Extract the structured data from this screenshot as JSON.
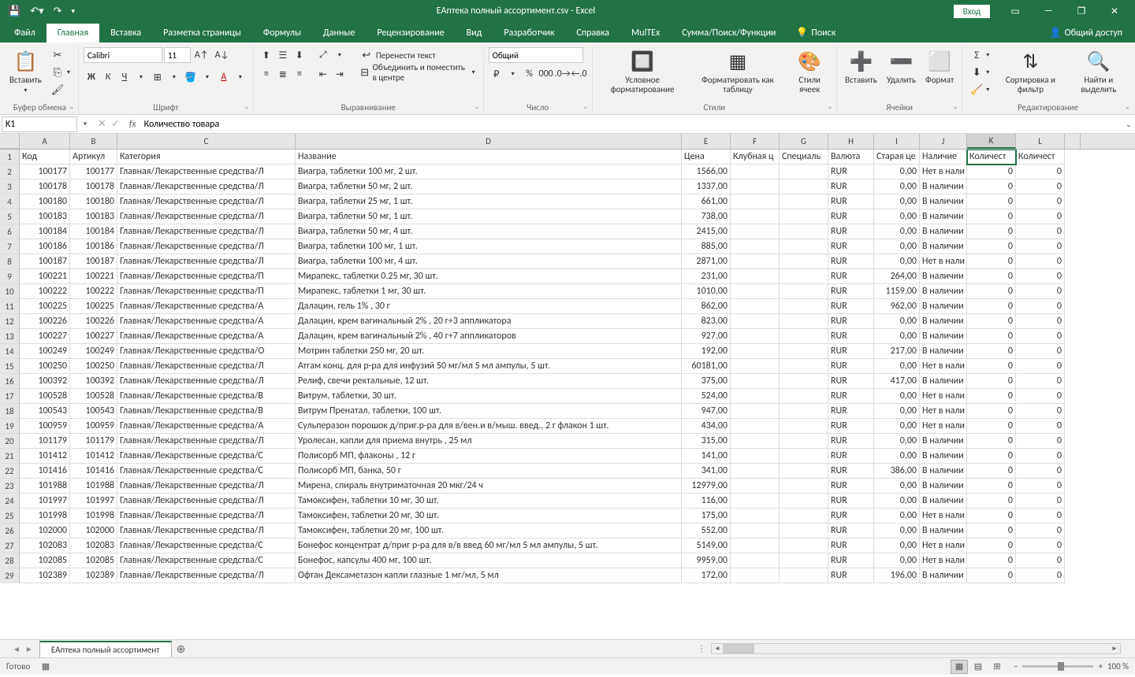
{
  "title": "ЕАптека полный ассортимент.csv - Excel",
  "login": "Вход",
  "tabs": [
    "Файл",
    "Главная",
    "Вставка",
    "Разметка страницы",
    "Формулы",
    "Данные",
    "Рецензирование",
    "Вид",
    "Разработчик",
    "Справка",
    "MulTEx",
    "Сумма/Поиск/Функции"
  ],
  "active_tab": "Главная",
  "tell_me": "Поиск",
  "share": "Общий доступ",
  "ribbon": {
    "paste": "Вставить",
    "clipboard_label": "Буфер обмена",
    "font_name": "Calibri",
    "font_size": "11",
    "font_label": "Шрифт",
    "wrap_text": "Перенести текст",
    "merge_center": "Объединить и поместить в центре",
    "alignment_label": "Выравнивание",
    "number_format": "Общий",
    "number_label": "Число",
    "cond_fmt": "Условное форматирование",
    "fmt_table": "Форматировать как таблицу",
    "cell_styles": "Стили ячеек",
    "styles_label": "Стили",
    "insert": "Вставить",
    "delete": "Удалить",
    "format": "Формат",
    "cells_label": "Ячейки",
    "sort_filter": "Сортировка и фильтр",
    "find_select": "Найти и выделить",
    "editing_label": "Редактирование"
  },
  "name_box": "K1",
  "formula_value": "Количество товара",
  "columns": [
    "A",
    "B",
    "C",
    "D",
    "E",
    "F",
    "G",
    "H",
    "I",
    "J",
    "K",
    "L"
  ],
  "selected_col": "K",
  "selected_cell": {
    "row": 1,
    "col": "K"
  },
  "headers": {
    "A": "Код",
    "B": "Артикул",
    "C": "Категория",
    "D": "Название",
    "E": "Цена",
    "F": "Клубная ц",
    "G": "Специаль",
    "H": "Валюта",
    "I": "Старая це",
    "J": "Наличие",
    "K": "Количест",
    "L": "Количест"
  },
  "rows": [
    {
      "n": 2,
      "A": "100177",
      "B": "100177",
      "C": "Главная/Лекарственные средства/Л",
      "D": "Виагра, таблетки 100 мг, 2 шт.",
      "E": "1566,00",
      "H": "RUR",
      "I": "0,00",
      "J": "Нет в нали",
      "K": "0",
      "L": "0"
    },
    {
      "n": 3,
      "A": "100178",
      "B": "100178",
      "C": "Главная/Лекарственные средства/Л",
      "D": "Виагра, таблетки 50 мг, 2 шт.",
      "E": "1337,00",
      "H": "RUR",
      "I": "0,00",
      "J": "В наличии",
      "K": "0",
      "L": "0"
    },
    {
      "n": 4,
      "A": "100180",
      "B": "100180",
      "C": "Главная/Лекарственные средства/Л",
      "D": "Виагра, таблетки 25 мг, 1 шт.",
      "E": "661,00",
      "H": "RUR",
      "I": "0,00",
      "J": "В наличии",
      "K": "0",
      "L": "0"
    },
    {
      "n": 5,
      "A": "100183",
      "B": "100183",
      "C": "Главная/Лекарственные средства/Л",
      "D": "Виагра, таблетки 50 мг, 1 шт.",
      "E": "738,00",
      "H": "RUR",
      "I": "0,00",
      "J": "В наличии",
      "K": "0",
      "L": "0"
    },
    {
      "n": 6,
      "A": "100184",
      "B": "100184",
      "C": "Главная/Лекарственные средства/Л",
      "D": "Виагра, таблетки 50 мг, 4 шт.",
      "E": "2415,00",
      "H": "RUR",
      "I": "0,00",
      "J": "В наличии",
      "K": "0",
      "L": "0"
    },
    {
      "n": 7,
      "A": "100186",
      "B": "100186",
      "C": "Главная/Лекарственные средства/Л",
      "D": "Виагра, таблетки 100 мг, 1 шт.",
      "E": "885,00",
      "H": "RUR",
      "I": "0,00",
      "J": "В наличии",
      "K": "0",
      "L": "0"
    },
    {
      "n": 8,
      "A": "100187",
      "B": "100187",
      "C": "Главная/Лекарственные средства/Л",
      "D": "Виагра, таблетки 100 мг, 4 шт.",
      "E": "2871,00",
      "H": "RUR",
      "I": "0,00",
      "J": "Нет в нали",
      "K": "0",
      "L": "0"
    },
    {
      "n": 9,
      "A": "100221",
      "B": "100221",
      "C": "Главная/Лекарственные средства/П",
      "D": "Мирапекс, таблетки 0.25 мг, 30 шт.",
      "E": "231,00",
      "H": "RUR",
      "I": "264,00",
      "J": "В наличии",
      "K": "0",
      "L": "0"
    },
    {
      "n": 10,
      "A": "100222",
      "B": "100222",
      "C": "Главная/Лекарственные средства/П",
      "D": "Мирапекс, таблетки 1 мг, 30 шт.",
      "E": "1010,00",
      "H": "RUR",
      "I": "1159,00",
      "J": "В наличии",
      "K": "0",
      "L": "0"
    },
    {
      "n": 11,
      "A": "100225",
      "B": "100225",
      "C": "Главная/Лекарственные средства/А",
      "D": "Далацин, гель 1% , 30 г",
      "E": "862,00",
      "H": "RUR",
      "I": "962,00",
      "J": "В наличии",
      "K": "0",
      "L": "0"
    },
    {
      "n": 12,
      "A": "100226",
      "B": "100226",
      "C": "Главная/Лекарственные средства/А",
      "D": "Далацин, крем вагинальный 2% , 20 г+3 аппликатора",
      "E": "823,00",
      "H": "RUR",
      "I": "0,00",
      "J": "В наличии",
      "K": "0",
      "L": "0"
    },
    {
      "n": 13,
      "A": "100227",
      "B": "100227",
      "C": "Главная/Лекарственные средства/А",
      "D": "Далацин, крем вагинальный 2% , 40 г+7 аппликаторов",
      "E": "927,00",
      "H": "RUR",
      "I": "0,00",
      "J": "В наличии",
      "K": "0",
      "L": "0"
    },
    {
      "n": 14,
      "A": "100249",
      "B": "100249",
      "C": "Главная/Лекарственные средства/О",
      "D": "Мотрин таблетки 250 мг, 20 шт.",
      "E": "192,00",
      "H": "RUR",
      "I": "217,00",
      "J": "В наличии",
      "K": "0",
      "L": "0"
    },
    {
      "n": 15,
      "A": "100250",
      "B": "100250",
      "C": "Главная/Лекарственные средства/Л",
      "D": "Атгам конц. для р-ра для инфузий 50 мг/мл 5 мл ампулы, 5 шт.",
      "E": "60181,00",
      "H": "RUR",
      "I": "0,00",
      "J": "Нет в нали",
      "K": "0",
      "L": "0"
    },
    {
      "n": 16,
      "A": "100392",
      "B": "100392",
      "C": "Главная/Лекарственные средства/Л",
      "D": "Релиф, свечи ректальные, 12 шт.",
      "E": "375,00",
      "H": "RUR",
      "I": "417,00",
      "J": "В наличии",
      "K": "0",
      "L": "0"
    },
    {
      "n": 17,
      "A": "100528",
      "B": "100528",
      "C": "Главная/Лекарственные средства/В",
      "D": "Витрум, таблетки, 30 шт.",
      "E": "524,00",
      "H": "RUR",
      "I": "0,00",
      "J": "Нет в нали",
      "K": "0",
      "L": "0"
    },
    {
      "n": 18,
      "A": "100543",
      "B": "100543",
      "C": "Главная/Лекарственные средства/В",
      "D": "Витрум Пренатал, таблетки, 100 шт.",
      "E": "947,00",
      "H": "RUR",
      "I": "0,00",
      "J": "Нет в нали",
      "K": "0",
      "L": "0"
    },
    {
      "n": 19,
      "A": "100959",
      "B": "100959",
      "C": "Главная/Лекарственные средства/А",
      "D": "Сульперазон порошок д/приг.р-ра для в/вен.и в/мыш. введ., 2 г флакон 1 шт.",
      "E": "434,00",
      "H": "RUR",
      "I": "0,00",
      "J": "Нет в нали",
      "K": "0",
      "L": "0"
    },
    {
      "n": 20,
      "A": "101179",
      "B": "101179",
      "C": "Главная/Лекарственные средства/Л",
      "D": "Уролесан, капли для приема внутрь , 25 мл",
      "E": "315,00",
      "H": "RUR",
      "I": "0,00",
      "J": "В наличии",
      "K": "0",
      "L": "0"
    },
    {
      "n": 21,
      "A": "101412",
      "B": "101412",
      "C": "Главная/Лекарственные средства/С",
      "D": "Полисорб МП, флаконы , 12 г",
      "E": "141,00",
      "H": "RUR",
      "I": "0,00",
      "J": "В наличии",
      "K": "0",
      "L": "0"
    },
    {
      "n": 22,
      "A": "101416",
      "B": "101416",
      "C": "Главная/Лекарственные средства/С",
      "D": "Полисорб МП, банка, 50 г",
      "E": "341,00",
      "H": "RUR",
      "I": "386,00",
      "J": "В наличии",
      "K": "0",
      "L": "0"
    },
    {
      "n": 23,
      "A": "101988",
      "B": "101988",
      "C": "Главная/Лекарственные средства/Л",
      "D": "Мирена, спираль внутриматочная 20 мкг/24 ч",
      "E": "12979,00",
      "H": "RUR",
      "I": "0,00",
      "J": "В наличии",
      "K": "0",
      "L": "0"
    },
    {
      "n": 24,
      "A": "101997",
      "B": "101997",
      "C": "Главная/Лекарственные средства/Л",
      "D": "Тамоксифен, таблетки 10 мг, 30 шт.",
      "E": "116,00",
      "H": "RUR",
      "I": "0,00",
      "J": "В наличии",
      "K": "0",
      "L": "0"
    },
    {
      "n": 25,
      "A": "101998",
      "B": "101998",
      "C": "Главная/Лекарственные средства/Л",
      "D": "Тамоксифен, таблетки 20 мг, 30 шт.",
      "E": "175,00",
      "H": "RUR",
      "I": "0,00",
      "J": "Нет в нали",
      "K": "0",
      "L": "0"
    },
    {
      "n": 26,
      "A": "102000",
      "B": "102000",
      "C": "Главная/Лекарственные средства/Л",
      "D": "Тамоксифен, таблетки 20 мг, 100 шт.",
      "E": "552,00",
      "H": "RUR",
      "I": "0,00",
      "J": "В наличии",
      "K": "0",
      "L": "0"
    },
    {
      "n": 27,
      "A": "102083",
      "B": "102083",
      "C": "Главная/Лекарственные средства/С",
      "D": "Бонефос концентрат д/приг р-ра для в/в введ 60 мг/мл 5 мл ампулы, 5 шт.",
      "E": "5149,00",
      "H": "RUR",
      "I": "0,00",
      "J": "Нет в нали",
      "K": "0",
      "L": "0"
    },
    {
      "n": 28,
      "A": "102085",
      "B": "102085",
      "C": "Главная/Лекарственные средства/С",
      "D": "Бонефос, капсулы 400 мг, 100 шт.",
      "E": "9959,00",
      "H": "RUR",
      "I": "0,00",
      "J": "Нет в нали",
      "K": "0",
      "L": "0"
    },
    {
      "n": 29,
      "A": "102389",
      "B": "102389",
      "C": "Главная/Лекарственные средства/Л",
      "D": "Офтан Дексаметазон капли глазные 1 мг/мл, 5 мл",
      "E": "172,00",
      "H": "RUR",
      "I": "196,00",
      "J": "В наличии",
      "K": "0",
      "L": "0"
    }
  ],
  "sheet_name": "ЕАптека полный ассортимент",
  "status": "Готово",
  "zoom": "100 %"
}
